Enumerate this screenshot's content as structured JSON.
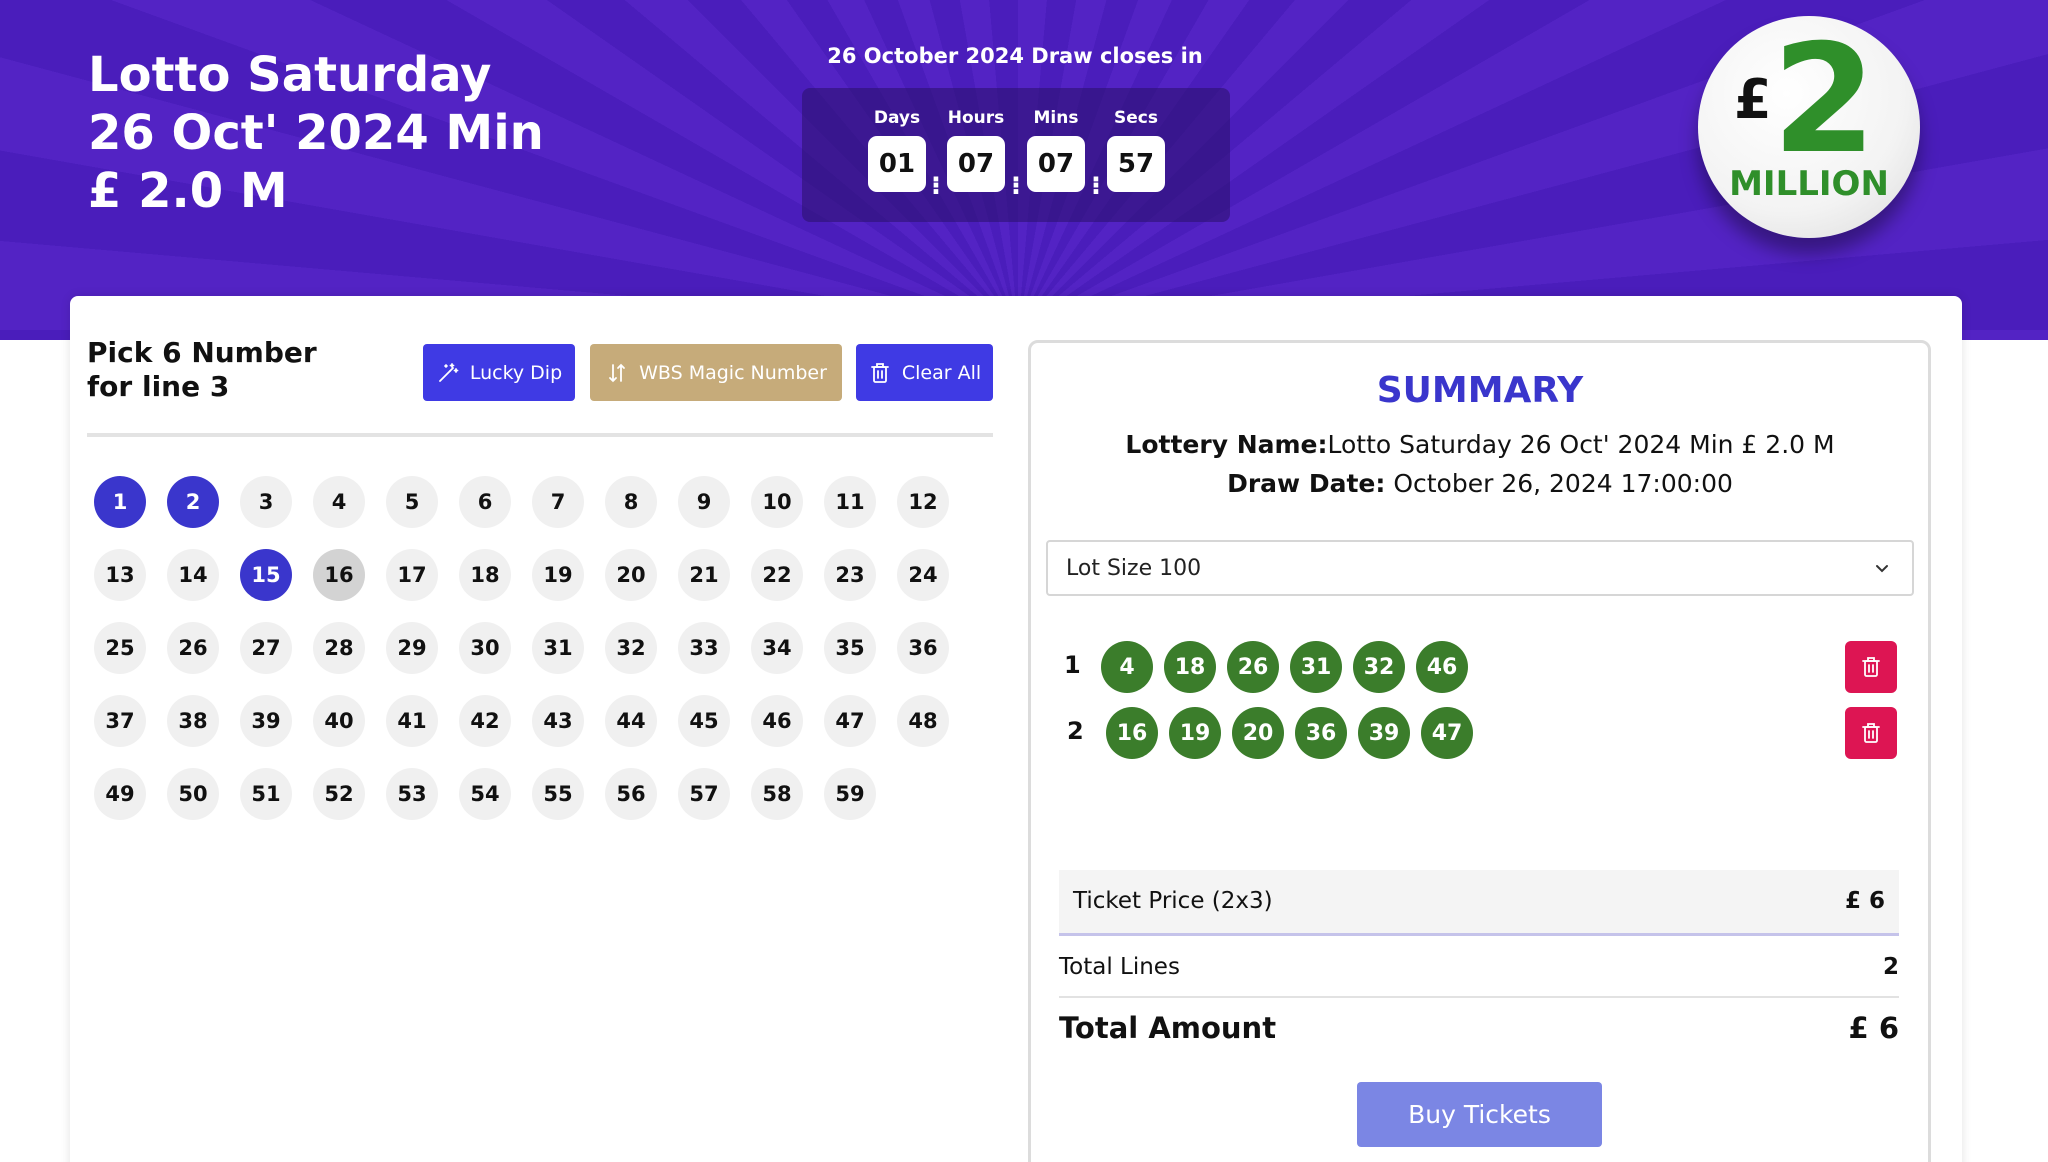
{
  "hero": {
    "title_lines": [
      "Lotto Saturday",
      "26 Oct' 2024 Min",
      "£ 2.0 M"
    ],
    "countdown_caption": "26 October 2024 Draw closes in",
    "countdown": {
      "days_label": "Days",
      "days": "01",
      "hours_label": "Hours",
      "hours": "07",
      "mins_label": "Mins",
      "mins": "07",
      "secs_label": "Secs",
      "secs": "57"
    },
    "badge": {
      "currency": "£",
      "amount": "2",
      "unit": "MILLION"
    }
  },
  "picker": {
    "title_line1": "Pick 6 Number",
    "title_line2": "for line 3",
    "buttons": {
      "lucky_dip": "Lucky Dip",
      "magic_number": "WBS Magic Number",
      "clear_all": "Clear All"
    },
    "numbers": [
      1,
      2,
      3,
      4,
      5,
      6,
      7,
      8,
      9,
      10,
      11,
      12,
      13,
      14,
      15,
      16,
      17,
      18,
      19,
      20,
      21,
      22,
      23,
      24,
      25,
      26,
      27,
      28,
      29,
      30,
      31,
      32,
      33,
      34,
      35,
      36,
      37,
      38,
      39,
      40,
      41,
      42,
      43,
      44,
      45,
      46,
      47,
      48,
      49,
      50,
      51,
      52,
      53,
      54,
      55,
      56,
      57,
      58,
      59
    ],
    "selected": [
      1,
      2,
      15
    ],
    "hovered": 16
  },
  "summary": {
    "title": "SUMMARY",
    "lottery_name_label": "Lottery Name:",
    "lottery_name": "Lotto Saturday 26 Oct' 2024 Min £ 2.0 M",
    "draw_date_label": "Draw Date:",
    "draw_date": "October 26, 2024 17:00:00",
    "lot_size_selected": "Lot Size 100",
    "lines": [
      {
        "number": "1",
        "balls": [
          4,
          18,
          26,
          31,
          32,
          46
        ]
      },
      {
        "number": "2",
        "balls": [
          16,
          19,
          20,
          36,
          39,
          47
        ]
      }
    ],
    "ticket_price_label": "Ticket Price (2x3)",
    "ticket_price": "£ 6",
    "total_lines_label": "Total Lines",
    "total_lines": "2",
    "total_amount_label": "Total Amount",
    "total_amount": "£ 6",
    "buy_button": "Buy Tickets"
  },
  "colors": {
    "hero_purple": "#5323c4",
    "accent_blue": "#3f3ae4",
    "magic_gold": "#c6ab7a",
    "line_green": "#3b7d2b",
    "delete_red": "#dd1553",
    "buy_button": "#7b86e4"
  },
  "icons": {
    "lucky_dip": "magic-wand-icon",
    "magic_number": "sort-arrows-icon",
    "clear_all": "trash-icon",
    "delete_line": "trash-icon",
    "select": "chevron-down-icon"
  }
}
